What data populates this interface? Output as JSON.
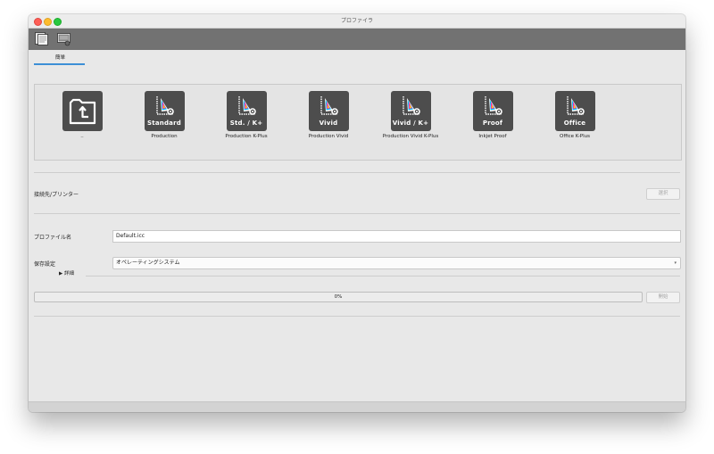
{
  "window": {
    "title": "プロファイラ"
  },
  "toolbar": {
    "buttons": [
      {
        "icon": "profile-page-icon"
      },
      {
        "icon": "printer-settings-icon"
      }
    ]
  },
  "tabs": [
    {
      "label": "簡単",
      "active": true
    }
  ],
  "colors": {
    "accent": "#3d8fd6",
    "tile": "#4d4d4d",
    "toolbar": "#727272"
  },
  "presets": [
    {
      "tag": "",
      "label": "..",
      "icon": "folder-up-icon"
    },
    {
      "tag": "Standard",
      "label": "Production",
      "icon": "color-profile-icon"
    },
    {
      "tag": "Std. / K+",
      "label": "Production K-Plus",
      "icon": "color-profile-icon"
    },
    {
      "tag": "Vivid",
      "label": "Production Vivid",
      "icon": "color-profile-icon"
    },
    {
      "tag": "Vivid / K+",
      "label": "Production Vivid K-Plus",
      "icon": "color-profile-icon"
    },
    {
      "tag": "Proof",
      "label": "Inkjet Proof",
      "icon": "color-profile-icon"
    },
    {
      "tag": "Office",
      "label": "Office K-Plus",
      "icon": "color-profile-icon"
    }
  ],
  "connection": {
    "label": "接続先/プリンター",
    "select_button": "選択"
  },
  "profile_name": {
    "label": "プロファイル名",
    "value": "Default.icc"
  },
  "save_settings": {
    "label": "保存設定",
    "value": "オペレーティングシステム"
  },
  "details": {
    "label": "▶ 詳細"
  },
  "progress": {
    "text": "0%",
    "value": 0,
    "start_button": "開始"
  }
}
